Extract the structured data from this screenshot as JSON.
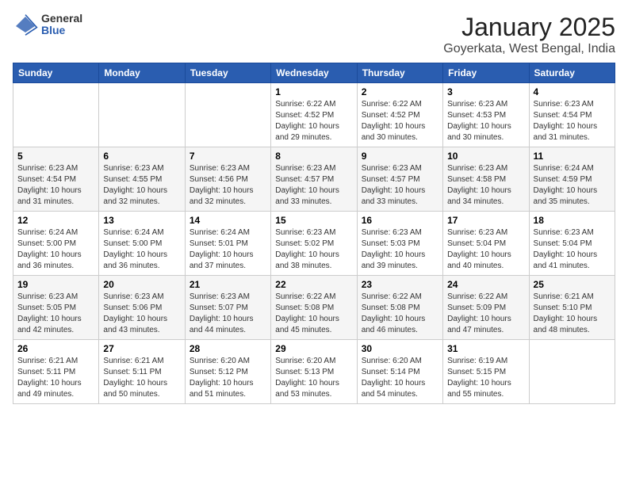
{
  "header": {
    "logo_general": "General",
    "logo_blue": "Blue",
    "month_title": "January 2025",
    "subtitle": "Goyerkata, West Bengal, India"
  },
  "weekdays": [
    "Sunday",
    "Monday",
    "Tuesday",
    "Wednesday",
    "Thursday",
    "Friday",
    "Saturday"
  ],
  "weeks": [
    [
      {
        "day": "",
        "info": ""
      },
      {
        "day": "",
        "info": ""
      },
      {
        "day": "",
        "info": ""
      },
      {
        "day": "1",
        "info": "Sunrise: 6:22 AM\nSunset: 4:52 PM\nDaylight: 10 hours\nand 29 minutes."
      },
      {
        "day": "2",
        "info": "Sunrise: 6:22 AM\nSunset: 4:52 PM\nDaylight: 10 hours\nand 30 minutes."
      },
      {
        "day": "3",
        "info": "Sunrise: 6:23 AM\nSunset: 4:53 PM\nDaylight: 10 hours\nand 30 minutes."
      },
      {
        "day": "4",
        "info": "Sunrise: 6:23 AM\nSunset: 4:54 PM\nDaylight: 10 hours\nand 31 minutes."
      }
    ],
    [
      {
        "day": "5",
        "info": "Sunrise: 6:23 AM\nSunset: 4:54 PM\nDaylight: 10 hours\nand 31 minutes."
      },
      {
        "day": "6",
        "info": "Sunrise: 6:23 AM\nSunset: 4:55 PM\nDaylight: 10 hours\nand 32 minutes."
      },
      {
        "day": "7",
        "info": "Sunrise: 6:23 AM\nSunset: 4:56 PM\nDaylight: 10 hours\nand 32 minutes."
      },
      {
        "day": "8",
        "info": "Sunrise: 6:23 AM\nSunset: 4:57 PM\nDaylight: 10 hours\nand 33 minutes."
      },
      {
        "day": "9",
        "info": "Sunrise: 6:23 AM\nSunset: 4:57 PM\nDaylight: 10 hours\nand 33 minutes."
      },
      {
        "day": "10",
        "info": "Sunrise: 6:23 AM\nSunset: 4:58 PM\nDaylight: 10 hours\nand 34 minutes."
      },
      {
        "day": "11",
        "info": "Sunrise: 6:24 AM\nSunset: 4:59 PM\nDaylight: 10 hours\nand 35 minutes."
      }
    ],
    [
      {
        "day": "12",
        "info": "Sunrise: 6:24 AM\nSunset: 5:00 PM\nDaylight: 10 hours\nand 36 minutes."
      },
      {
        "day": "13",
        "info": "Sunrise: 6:24 AM\nSunset: 5:00 PM\nDaylight: 10 hours\nand 36 minutes."
      },
      {
        "day": "14",
        "info": "Sunrise: 6:24 AM\nSunset: 5:01 PM\nDaylight: 10 hours\nand 37 minutes."
      },
      {
        "day": "15",
        "info": "Sunrise: 6:23 AM\nSunset: 5:02 PM\nDaylight: 10 hours\nand 38 minutes."
      },
      {
        "day": "16",
        "info": "Sunrise: 6:23 AM\nSunset: 5:03 PM\nDaylight: 10 hours\nand 39 minutes."
      },
      {
        "day": "17",
        "info": "Sunrise: 6:23 AM\nSunset: 5:04 PM\nDaylight: 10 hours\nand 40 minutes."
      },
      {
        "day": "18",
        "info": "Sunrise: 6:23 AM\nSunset: 5:04 PM\nDaylight: 10 hours\nand 41 minutes."
      }
    ],
    [
      {
        "day": "19",
        "info": "Sunrise: 6:23 AM\nSunset: 5:05 PM\nDaylight: 10 hours\nand 42 minutes."
      },
      {
        "day": "20",
        "info": "Sunrise: 6:23 AM\nSunset: 5:06 PM\nDaylight: 10 hours\nand 43 minutes."
      },
      {
        "day": "21",
        "info": "Sunrise: 6:23 AM\nSunset: 5:07 PM\nDaylight: 10 hours\nand 44 minutes."
      },
      {
        "day": "22",
        "info": "Sunrise: 6:22 AM\nSunset: 5:08 PM\nDaylight: 10 hours\nand 45 minutes."
      },
      {
        "day": "23",
        "info": "Sunrise: 6:22 AM\nSunset: 5:08 PM\nDaylight: 10 hours\nand 46 minutes."
      },
      {
        "day": "24",
        "info": "Sunrise: 6:22 AM\nSunset: 5:09 PM\nDaylight: 10 hours\nand 47 minutes."
      },
      {
        "day": "25",
        "info": "Sunrise: 6:21 AM\nSunset: 5:10 PM\nDaylight: 10 hours\nand 48 minutes."
      }
    ],
    [
      {
        "day": "26",
        "info": "Sunrise: 6:21 AM\nSunset: 5:11 PM\nDaylight: 10 hours\nand 49 minutes."
      },
      {
        "day": "27",
        "info": "Sunrise: 6:21 AM\nSunset: 5:11 PM\nDaylight: 10 hours\nand 50 minutes."
      },
      {
        "day": "28",
        "info": "Sunrise: 6:20 AM\nSunset: 5:12 PM\nDaylight: 10 hours\nand 51 minutes."
      },
      {
        "day": "29",
        "info": "Sunrise: 6:20 AM\nSunset: 5:13 PM\nDaylight: 10 hours\nand 53 minutes."
      },
      {
        "day": "30",
        "info": "Sunrise: 6:20 AM\nSunset: 5:14 PM\nDaylight: 10 hours\nand 54 minutes."
      },
      {
        "day": "31",
        "info": "Sunrise: 6:19 AM\nSunset: 5:15 PM\nDaylight: 10 hours\nand 55 minutes."
      },
      {
        "day": "",
        "info": ""
      }
    ]
  ]
}
